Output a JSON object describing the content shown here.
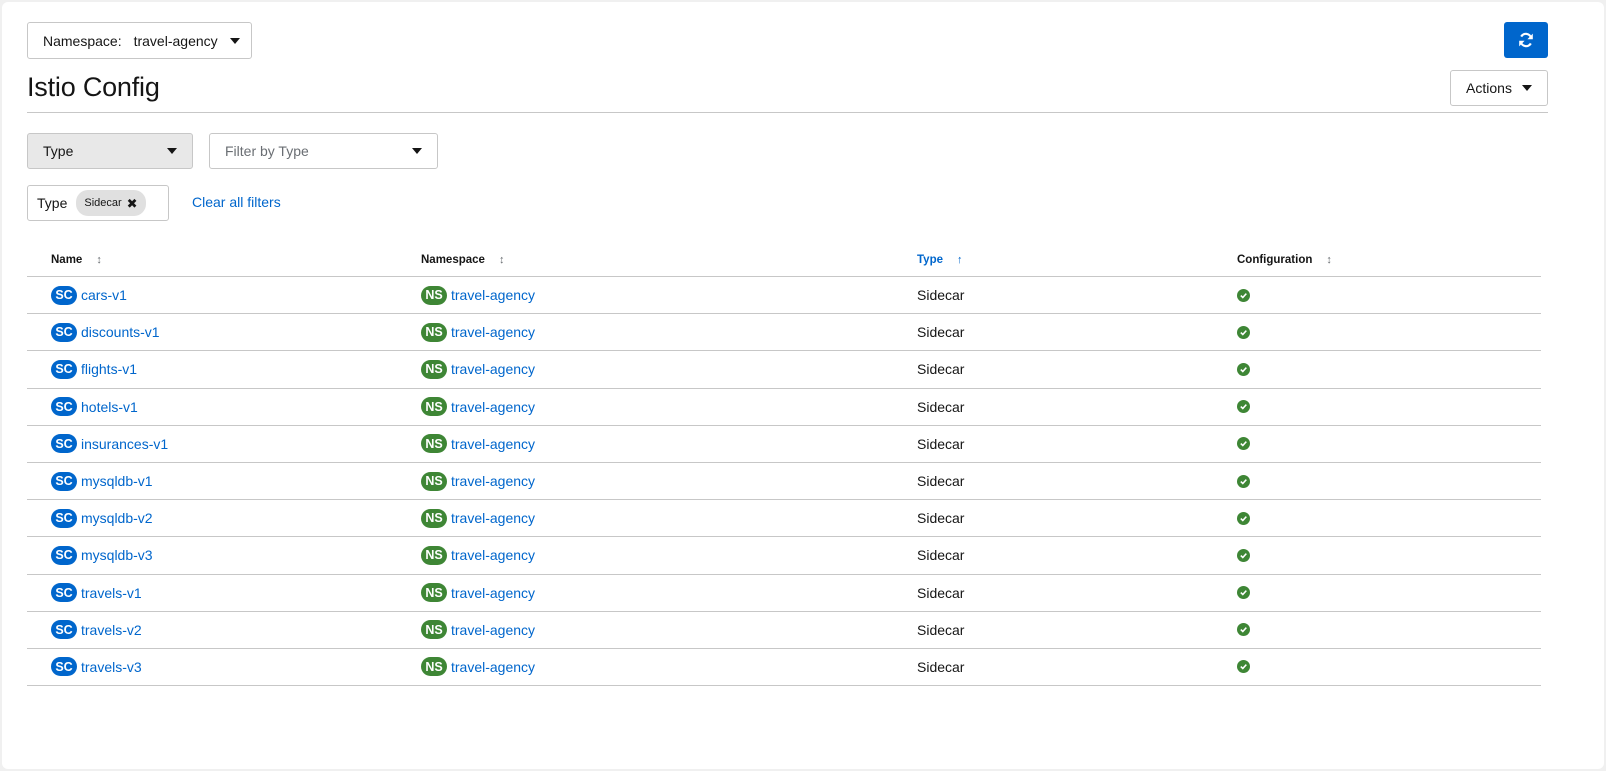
{
  "namespace_selector": {
    "label": "Namespace:",
    "value": "travel-agency"
  },
  "page": {
    "title": "Istio Config"
  },
  "actions": {
    "label": "Actions"
  },
  "filters": {
    "type_select": "Type",
    "filter_placeholder": "Filter by Type",
    "active": {
      "category": "Type",
      "chip": "Sidecar"
    },
    "clear_all": "Clear all filters"
  },
  "table": {
    "columns": [
      {
        "label": "Name",
        "sort": "unsorted"
      },
      {
        "label": "Namespace",
        "sort": "unsorted"
      },
      {
        "label": "Type",
        "sort": "ascending"
      },
      {
        "label": "Configuration",
        "sort": "unsorted"
      }
    ],
    "rows": [
      {
        "badge": "SC",
        "name": "cars-v1",
        "ns_badge": "NS",
        "namespace": "travel-agency",
        "type": "Sidecar",
        "config": "valid"
      },
      {
        "badge": "SC",
        "name": "discounts-v1",
        "ns_badge": "NS",
        "namespace": "travel-agency",
        "type": "Sidecar",
        "config": "valid"
      },
      {
        "badge": "SC",
        "name": "flights-v1",
        "ns_badge": "NS",
        "namespace": "travel-agency",
        "type": "Sidecar",
        "config": "valid"
      },
      {
        "badge": "SC",
        "name": "hotels-v1",
        "ns_badge": "NS",
        "namespace": "travel-agency",
        "type": "Sidecar",
        "config": "valid"
      },
      {
        "badge": "SC",
        "name": "insurances-v1",
        "ns_badge": "NS",
        "namespace": "travel-agency",
        "type": "Sidecar",
        "config": "valid"
      },
      {
        "badge": "SC",
        "name": "mysqldb-v1",
        "ns_badge": "NS",
        "namespace": "travel-agency",
        "type": "Sidecar",
        "config": "valid"
      },
      {
        "badge": "SC",
        "name": "mysqldb-v2",
        "ns_badge": "NS",
        "namespace": "travel-agency",
        "type": "Sidecar",
        "config": "valid"
      },
      {
        "badge": "SC",
        "name": "mysqldb-v3",
        "ns_badge": "NS",
        "namespace": "travel-agency",
        "type": "Sidecar",
        "config": "valid"
      },
      {
        "badge": "SC",
        "name": "travels-v1",
        "ns_badge": "NS",
        "namespace": "travel-agency",
        "type": "Sidecar",
        "config": "valid"
      },
      {
        "badge": "SC",
        "name": "travels-v2",
        "ns_badge": "NS",
        "namespace": "travel-agency",
        "type": "Sidecar",
        "config": "valid"
      },
      {
        "badge": "SC",
        "name": "travels-v3",
        "ns_badge": "NS",
        "namespace": "travel-agency",
        "type": "Sidecar",
        "config": "valid"
      }
    ]
  },
  "colors": {
    "primary": "#0066cc",
    "namespace_badge": "#3e8635",
    "valid": "#3e8635"
  }
}
